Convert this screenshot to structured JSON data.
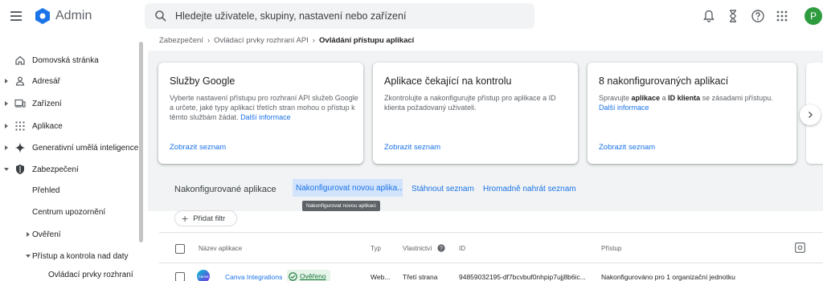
{
  "header": {
    "app_name": "Admin",
    "search_placeholder": "Hledejte uživatele, skupiny, nastavení nebo zařízení",
    "avatar_letter": "P"
  },
  "breadcrumb": {
    "items": [
      "Zabezpečení",
      "Ovládací prvky rozhraní API"
    ],
    "separator": "›",
    "current": "Ovládání přístupu aplikací"
  },
  "sidebar": {
    "items": [
      {
        "label": "Domovská stránka"
      },
      {
        "label": "Adresář"
      },
      {
        "label": "Zařízení"
      },
      {
        "label": "Aplikace"
      },
      {
        "label": "Generativní umělá inteligence"
      },
      {
        "label": "Zabezpečení"
      },
      {
        "label": "Přehled"
      },
      {
        "label": "Centrum upozornění"
      },
      {
        "label": "Ověření"
      },
      {
        "label": "Přístup a kontrola nad daty"
      },
      {
        "label": "Ovládací prvky rozhraní"
      }
    ]
  },
  "cards": [
    {
      "title": "Služby Google",
      "desc": "Vyberte nastavení přístupu pro rozhraní API služeb Google a určete, jaké typy aplikací třetích stran mohou o přístup k těmto službám žádat.",
      "desc_link": "Další informace",
      "footer": "Zobrazit seznam"
    },
    {
      "title": "Aplikace čekající na kontrolu",
      "desc": "Zkontrolujte a nakonfigurujte přístup pro aplikace a ID klienta požadovaný uživateli.",
      "footer": "Zobrazit seznam"
    },
    {
      "title": "8 nakonfigurovaných aplikací",
      "desc_prefix": "Spravujte",
      "desc_b1": "aplikace",
      "desc_mid": "a",
      "desc_b2": "ID klienta",
      "desc_suffix": "se zásadami přístupu.",
      "desc_link": "Další informace",
      "footer": "Zobrazit seznam"
    }
  ],
  "table_section": {
    "title": "Nakonfigurované aplikace",
    "tabs": [
      "Nakonfigurovat novou aplika...",
      "Stáhnout seznam",
      "Hromadně nahrát seznam"
    ],
    "tooltip": "Nakonfigurovat novou aplikaci",
    "filter_label": "Přidat filtr",
    "columns": [
      "Název aplikace",
      "Typ",
      "Vlastnictví",
      "ID",
      "Přístup"
    ],
    "rows": [
      {
        "logo_text": "Canva",
        "name": "Canva Integrations",
        "verified": "Ověřeno",
        "type": "Web...",
        "ownership": "Třetí strana",
        "id": "94859032195-df7bcvbuf0nhpip7ujj8b6ic...",
        "access": "Nakonfigurováno pro 1 organizační jednotku"
      }
    ]
  },
  "colors": {
    "accent": "#1a73e8",
    "avatar": "#2e9c3e",
    "verified_bg": "#e6f4ea",
    "verified_text": "#137333"
  }
}
